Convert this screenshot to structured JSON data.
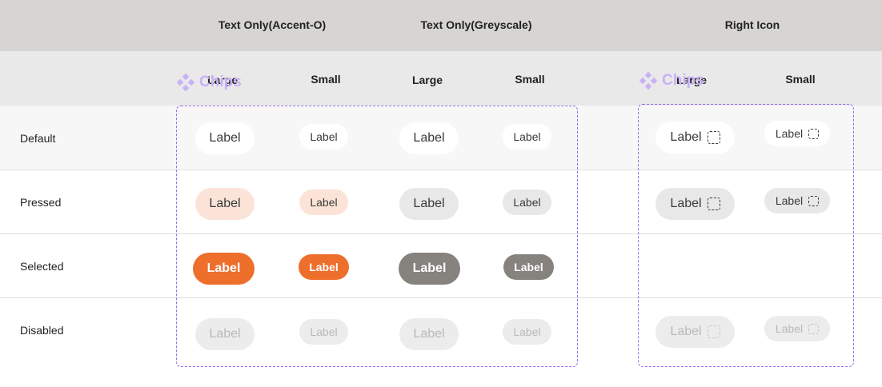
{
  "column_groups": {
    "accent": "Text Only(Accent-O)",
    "greyscale": "Text Only(Greyscale)",
    "right_icon": "Right Icon"
  },
  "sizes": {
    "large": "Large",
    "small": "Small"
  },
  "states": {
    "default": "Default",
    "pressed": "Pressed",
    "selected": "Selected",
    "disabled": "Disabled"
  },
  "frame_tag": "Chips",
  "chip_label": "Label",
  "icons": {
    "chip_trailing": "dashed-square-icon",
    "frame_tag": "component-diamond-icon"
  },
  "colors": {
    "accent": "#ee6f2c",
    "accent_pressed": "#fbe4d7",
    "grey_selected": "#86827e",
    "frame_border": "#9a6cf0"
  }
}
